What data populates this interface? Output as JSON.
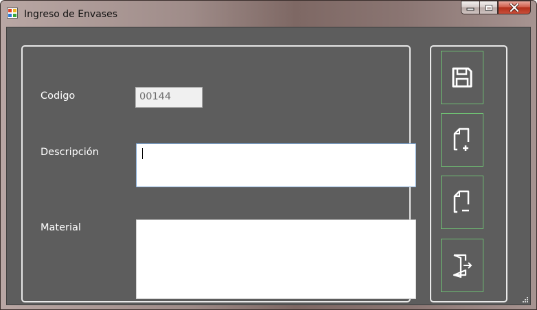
{
  "window": {
    "title": "Ingreso de Envases",
    "app_icon": "windows-form-icon",
    "controls": {
      "minimize_icon": "minimize-icon",
      "maximize_icon": "maximize-icon",
      "close_icon": "close-icon"
    }
  },
  "form": {
    "codigo": {
      "label": "Codigo",
      "value": "00144"
    },
    "descripcion": {
      "label": "Descripción",
      "value": ""
    },
    "material": {
      "label": "Material",
      "value": ""
    }
  },
  "toolbar": {
    "buttons": [
      {
        "name": "save",
        "icon": "floppy-disk-icon"
      },
      {
        "name": "new",
        "icon": "document-add-icon"
      },
      {
        "name": "delete",
        "icon": "document-remove-icon"
      },
      {
        "name": "exit",
        "icon": "exit-door-icon"
      }
    ]
  },
  "colors": {
    "client_background": "#5d5d5d",
    "group_border": "#e9e9e9",
    "button_border": "#6fbf73",
    "close_button": "#c9432f"
  }
}
